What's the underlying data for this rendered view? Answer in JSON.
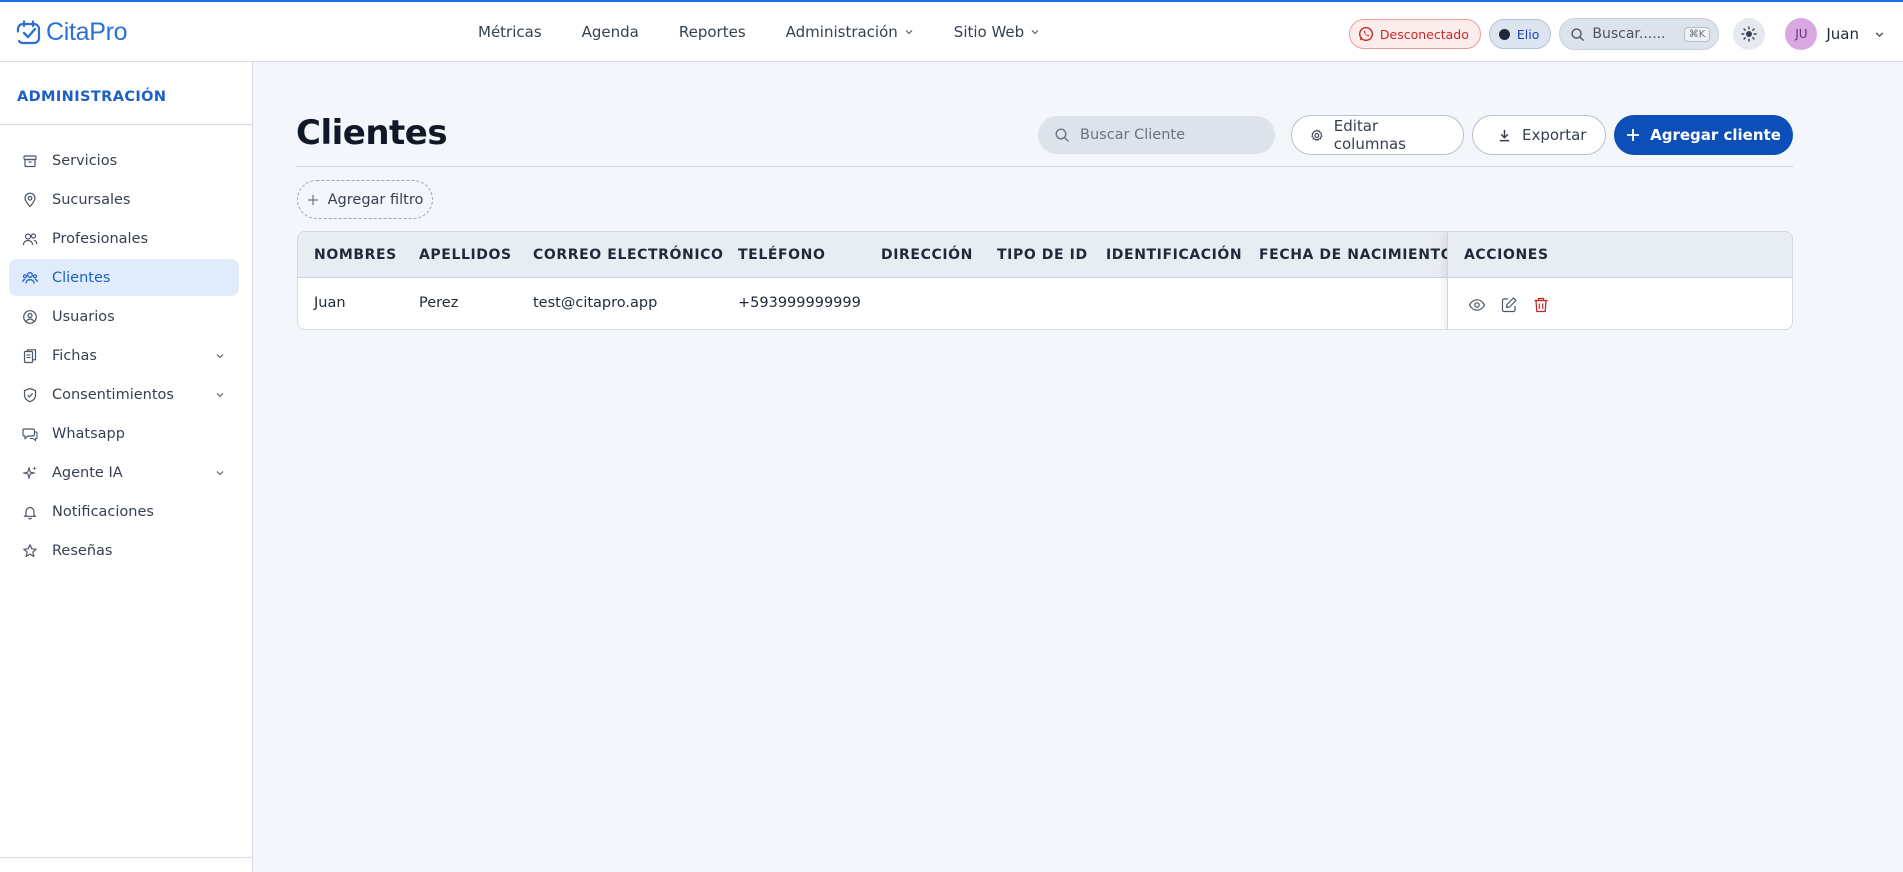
{
  "brand": {
    "name_prefix": "Cita",
    "name_suffix": "Pro"
  },
  "topnav": [
    {
      "label": "Métricas"
    },
    {
      "label": "Agenda"
    },
    {
      "label": "Reportes"
    },
    {
      "label": "Administración"
    },
    {
      "label": "Sitio Web"
    }
  ],
  "header": {
    "whatsapp_status": "Desconectado",
    "assistant": "Elio",
    "search_placeholder": "Buscar......",
    "search_shortcut": "⌘K",
    "user_initials": "JU",
    "user_name": "Juan"
  },
  "sidebar": {
    "title": "ADMINISTRACIÓN",
    "items": [
      {
        "label": "Servicios",
        "icon": "box-icon"
      },
      {
        "label": "Sucursales",
        "icon": "map-pin-icon"
      },
      {
        "label": "Profesionales",
        "icon": "users-icon"
      },
      {
        "label": "Clientes",
        "icon": "user-group-icon",
        "active": true
      },
      {
        "label": "Usuarios",
        "icon": "user-circle-icon"
      },
      {
        "label": "Fichas",
        "icon": "files-icon",
        "expandable": true
      },
      {
        "label": "Consentimientos",
        "icon": "shield-check-icon",
        "expandable": true
      },
      {
        "label": "Whatsapp",
        "icon": "chat-icon"
      },
      {
        "label": "Agente IA",
        "icon": "sparkles-icon",
        "expandable": true
      },
      {
        "label": "Notificaciones",
        "icon": "bell-icon"
      },
      {
        "label": "Reseñas",
        "icon": "star-icon"
      }
    ]
  },
  "main": {
    "title": "Clientes",
    "search_placeholder": "Buscar Cliente",
    "edit_columns_label": "Editar columnas",
    "export_label": "Exportar",
    "add_client_label": "Agregar cliente",
    "add_filter_label": "Agregar filtro"
  },
  "table": {
    "columns": [
      "NOMBRES",
      "APELLIDOS",
      "CORREO ELECTRÓNICO",
      "TELÉFONO",
      "DIRECCIÓN",
      "TIPO DE ID",
      "IDENTIFICACIÓN",
      "FECHA DE NACIMIENTO",
      "ACCIONES"
    ],
    "rows": [
      {
        "nombres": "Juan",
        "apellidos": "Perez",
        "correo": "test@citapro.app",
        "telefono": "+593999999999",
        "direccion": "",
        "tipo_id": "",
        "identificacion": "",
        "fecha_nacimiento": ""
      }
    ]
  },
  "colors": {
    "primary": "#0d4fb8",
    "accent": "#1d5fc4",
    "danger": "#c62828"
  }
}
